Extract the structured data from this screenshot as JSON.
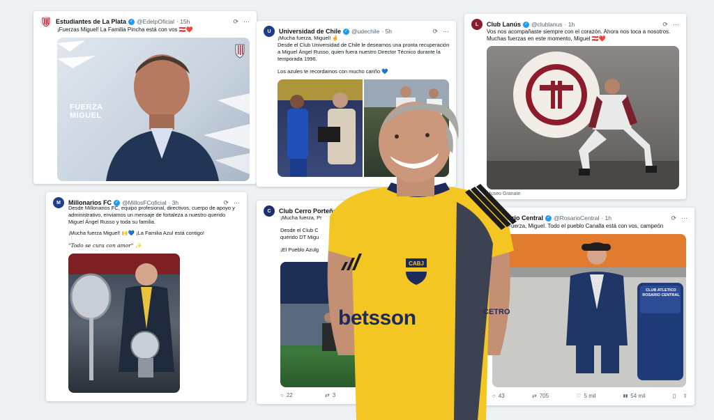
{
  "cards": {
    "estudiantes": {
      "name": "Estudiantes de La Plata",
      "handle": "@EdelpOficial",
      "time": "· 15h",
      "text": "¡Fuerzas Miguel! La Familia Pincha está con vos 🇦🇹❤️",
      "overlay": "FUERZA\nMIGUEL"
    },
    "udechile": {
      "name": "Universidad de Chile",
      "handle": "@udechile",
      "time": "· 5h",
      "text1": "¡Mucha fuerza, Miguel! 🤞",
      "text2": "Desde el Club Universidad de Chile le deseamos una pronta recuperación a Miguel Ángel Russo, quien fuera nuestro Director Técnico durante la temporada 1996.",
      "text3": "Los azules te recordamos con mucho cariño 💙"
    },
    "lanus": {
      "name": "Club Lanús",
      "handle": "@clublanus",
      "time": "· 1h",
      "text": "Vos nos acompañaste siempre con el corazón. Ahora nos toca a nosotros. Muchas fuerzas en este momento, Miguel 🇦🇹❤️",
      "caption": "Museo Granate"
    },
    "millonarios": {
      "name": "Millonarios FC",
      "handle": "@MillosFCoficial",
      "time": "· 3h",
      "text1": "Desde Millonarios FC, equipo profesional, directivos, cuerpo de apoyo y administrativo, enviamos un mensaje de fortaleza a nuestro querido Miguel Ángel Russo y toda su familia.",
      "text2": "¡Mucha fuerza Miguel! 🙌💙 ¡La Familia Azul está contigo!",
      "text3": "\"Todo se cura con amor\" ✨"
    },
    "cerro": {
      "name": "Club Cerro Porteño",
      "text1": "¡Mucha fuerza, Pr",
      "text2": "Desde el Club C",
      "text3": "querido DT Migu",
      "text4": "¡El Pueblo Azulg",
      "replies": "22",
      "retweets": "3"
    },
    "rosario": {
      "name": "Rosario Central",
      "handle": "@RosarioCentral",
      "time": "· 1h",
      "text": "💛💙 Fuerza, Miguel. Todo el pueblo Canalla está con vos, campeón",
      "wall_text": "CLUB ATLETICO ROSARIO CENTRAL",
      "replies": "43",
      "retweets": "705",
      "likes": "5 mil",
      "views": "54 mil"
    }
  },
  "player": {
    "sponsor": "betsson",
    "sleeve": "CETRO",
    "crest": "CABJ"
  },
  "icons": {
    "grok": "⟳",
    "more": "···",
    "reply": "○",
    "retweet": "⇄",
    "like": "♡",
    "views": "▮▮",
    "bookmark": "▯",
    "share": "⇪",
    "check": "✓"
  },
  "colors": {
    "verified": "#1d9bf0",
    "boca_yellow": "#f3c623",
    "boca_blue": "#1c2a5c",
    "lanus_red": "#8c1b2b"
  }
}
